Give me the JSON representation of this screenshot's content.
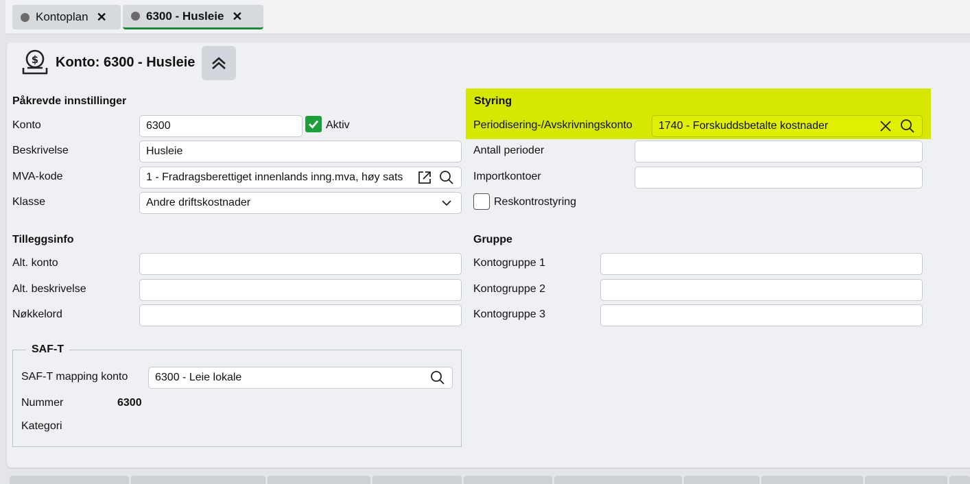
{
  "tabs": [
    {
      "label": "Kontoplan"
    },
    {
      "label": "6300 - Husleie"
    }
  ],
  "header": {
    "title": "Konto: 6300 - Husleie"
  },
  "required": {
    "title": "Påkrevde innstillinger",
    "konto_label": "Konto",
    "konto_value": "6300",
    "aktiv_label": "Aktiv",
    "beskrivelse_label": "Beskrivelse",
    "beskrivelse_value": "Husleie",
    "mva_label": "MVA-kode",
    "mva_value": "1 - Fradragsberettiget innenlands inng.mva, høy sats",
    "klasse_label": "Klasse",
    "klasse_value": "Andre driftskostnader"
  },
  "styring": {
    "title": "Styring",
    "periodisering_label": "Periodisering-/Avskrivningskonto",
    "periodisering_value": "1740 - Forskuddsbetalte kostnader",
    "antall_label": "Antall perioder",
    "import_label": "Importkontoer",
    "reskontro_label": "Reskontrostyring"
  },
  "tillegg": {
    "title": "Tilleggsinfo",
    "alt_konto_label": "Alt. konto",
    "alt_beskrivelse_label": "Alt. beskrivelse",
    "nokkelord_label": "Nøkkelord"
  },
  "gruppe": {
    "title": "Gruppe",
    "kg1_label": "Kontogruppe 1",
    "kg2_label": "Kontogruppe 2",
    "kg3_label": "Kontogruppe 3"
  },
  "saft": {
    "title": "SAF-T",
    "mapping_label": "SAF-T mapping konto",
    "mapping_value": "6300 - Leie lokale",
    "nummer_label": "Nummer",
    "nummer_value": "6300",
    "kategori_label": "Kategori"
  },
  "colors": {
    "accent": "#1b8a3a",
    "highlight": "#d6e800",
    "check": "#1e9e3a"
  }
}
